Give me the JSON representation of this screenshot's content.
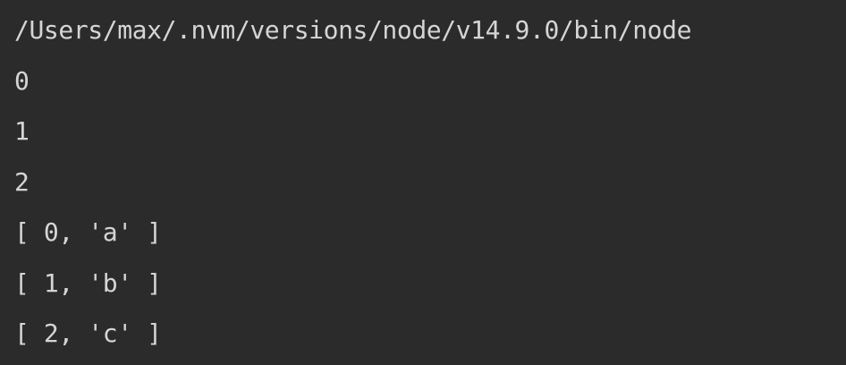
{
  "console": {
    "command_path": "/Users/max/.nvm/versions/node/v14.9.0/bin/node",
    "output_lines": [
      "0",
      "1",
      "2",
      "[ 0, 'a' ]",
      "[ 1, 'b' ]",
      "[ 2, 'c' ]"
    ]
  }
}
